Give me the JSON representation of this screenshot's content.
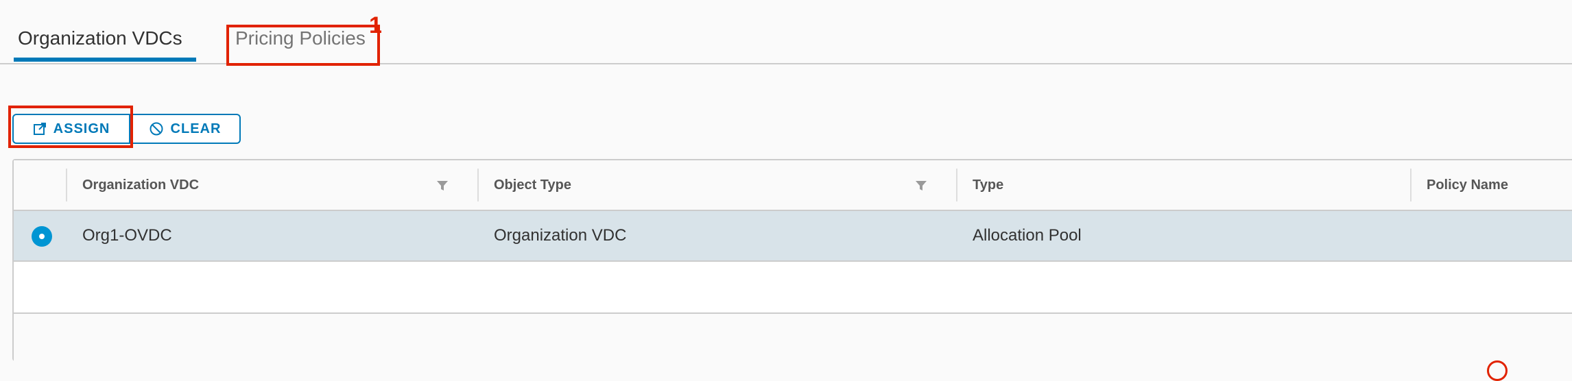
{
  "tabs": [
    {
      "label": "Organization VDCs",
      "active": true
    },
    {
      "label": "Pricing Policies",
      "active": false
    }
  ],
  "annotations": {
    "pricing_tab_number": "1"
  },
  "toolbar": {
    "assign_label": "ASSIGN",
    "clear_label": "CLEAR",
    "assign_icon": "assign-icon",
    "clear_icon": "ban-icon"
  },
  "grid": {
    "columns": [
      "Organization VDC",
      "Object Type",
      "Type",
      "Policy Name"
    ],
    "rows": [
      {
        "selected": true,
        "cells": [
          "Org1-OVDC",
          "Organization VDC",
          "Allocation Pool",
          ""
        ]
      }
    ]
  },
  "colors": {
    "accent": "#0079b8",
    "annotation": "#e12200",
    "selected_row": "#d8e3e9"
  }
}
